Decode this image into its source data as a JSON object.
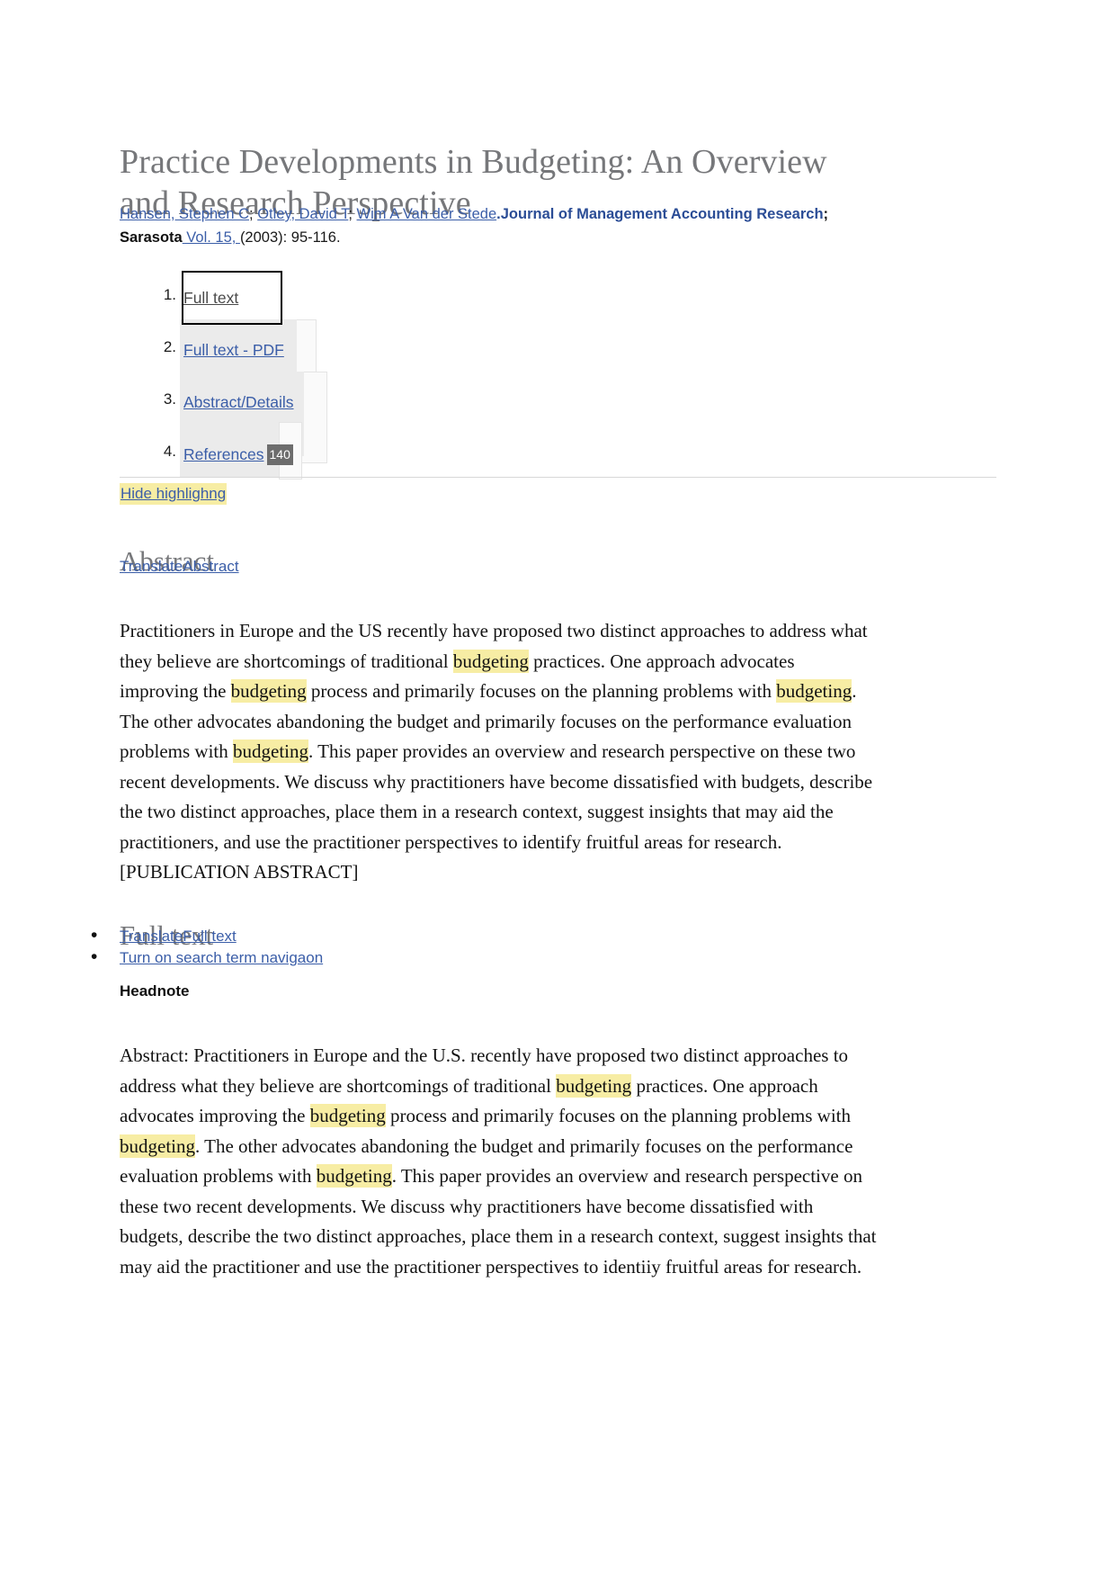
{
  "document": {
    "title": "Practice Developments in Budgeting: An Overview and Research Perspective"
  },
  "citation": {
    "authors": [
      "Hansen, Stephen C",
      "Otley, David T",
      "Wim A Van der Stede"
    ],
    "separator": "; ",
    "period": ".",
    "journal": "Journal of Management Accounting Research",
    "source": "; Sarasota",
    "volume": " Vol. 15, ",
    "year_pages": "(2003): 95-116."
  },
  "links_list": [
    {
      "num": "1.",
      "label": "Full text",
      "badge": ""
    },
    {
      "num": "2.",
      "label": "Full text - PDF",
      "badge": ""
    },
    {
      "num": "3.",
      "label": "Abstract/Details",
      "badge": ""
    },
    {
      "num": "4.",
      "label": "References",
      "badge": "140"
    }
  ],
  "toolbar": {
    "hide_highlighting": "Hide highlighng"
  },
  "abstract": {
    "heading": "Abstract",
    "translate_label": "TranslateAbstract",
    "paragraph_parts": [
      {
        "t": "Practitioners in Europe and the US recently have proposed two distinct approaches to address what they believe are shortcomings of traditional ",
        "h": false
      },
      {
        "t": "budgeting",
        "h": true
      },
      {
        "t": " practices. One approach advocates improving the ",
        "h": false
      },
      {
        "t": "budgeting",
        "h": true
      },
      {
        "t": " process and primarily focuses on the planning problems with ",
        "h": false
      },
      {
        "t": "budgeting",
        "h": true
      },
      {
        "t": ". The other advocates abandoning the budget and primarily focuses on the performance evaluation problems with ",
        "h": false
      },
      {
        "t": "budgeting",
        "h": true
      },
      {
        "t": ". This paper provides an overview and research perspective on these two recent developments. We discuss why practitioners have become dissatisfied with budgets, describe the two distinct approaches, place them in a research context, suggest insights that may aid the practitioners, and use the practitioner perspectives to identify fruitful areas for research. [PUBLICATION ABSTRACT]",
        "h": false
      }
    ]
  },
  "full_text": {
    "heading": "Full text",
    "links": [
      "TranslateFull text",
      "Turn on search term navigaon"
    ],
    "headnote_label": "Headnote",
    "paragraph_parts": [
      {
        "t": "Abstract: Practitioners in Europe and the U.S. recently have proposed two distinct approaches to address what they believe are shortcomings of traditional ",
        "h": false
      },
      {
        "t": "budgeting",
        "h": true
      },
      {
        "t": " practices. One approach advocates improving the ",
        "h": false
      },
      {
        "t": "budgeting",
        "h": true
      },
      {
        "t": " process and primarily focuses on the planning problems with ",
        "h": false
      },
      {
        "t": "budgeting",
        "h": true
      },
      {
        "t": ". The other advocates abandoning the budget and primarily focuses on the performance evaluation problems with ",
        "h": false
      },
      {
        "t": "budgeting",
        "h": true
      },
      {
        "t": ". This paper provides an overview and research perspective on these two recent developments. We discuss why practitioners have become dissatisfied with budgets, describe the two distinct approaches, place them in a research context, suggest insights that may aid the practitioner and use the practitioner perspectives to identiiy fruitful areas for research.",
        "h": false
      }
    ]
  },
  "colors": {
    "link": "#3b5ea8",
    "journal": "#2b4d96",
    "heading": "#77787b",
    "highlight": "#f7eda4",
    "badge_bg": "#6d6d6d",
    "ghost_panel": "#ebebeb"
  }
}
